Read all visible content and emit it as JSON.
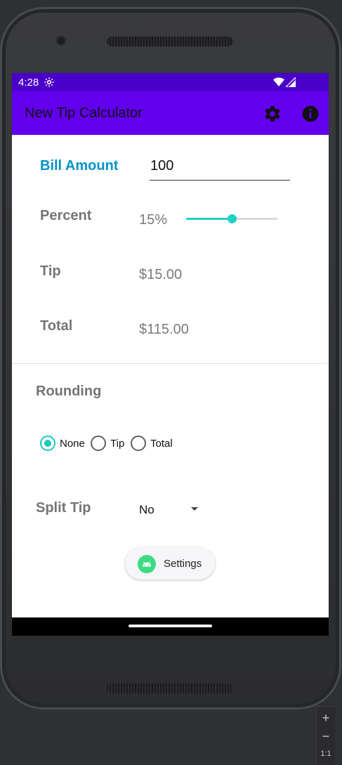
{
  "status_bar": {
    "time": "4:28",
    "icons": [
      "settings-icon",
      "wifi-icon",
      "signal-icon"
    ]
  },
  "app_bar": {
    "title": "New Tip Calculator",
    "actions": [
      "settings-icon",
      "info-icon"
    ],
    "color": "#6200ee"
  },
  "bill": {
    "label": "Bill Amount",
    "value": "100"
  },
  "percent": {
    "label": "Percent",
    "value_text": "15%",
    "slider_fraction": 0.5
  },
  "tip": {
    "label": "Tip",
    "value": "$15.00"
  },
  "total": {
    "label": "Total",
    "value": "$115.00"
  },
  "rounding": {
    "label": "Rounding",
    "options": [
      "None",
      "Tip",
      "Total"
    ],
    "selected": "None"
  },
  "split_tip": {
    "label": "Split Tip",
    "value": "No"
  },
  "settings_button": {
    "label": "Settings",
    "icon": "android-icon"
  },
  "emulator_zoom": {
    "zoom_in": "+",
    "zoom_out": "−",
    "actual_size": "1:1"
  },
  "colors": {
    "status_bar": "#4a00c8",
    "app_bar": "#6200ee",
    "accent": "#0295c8",
    "slider": "#1fd0c5"
  }
}
